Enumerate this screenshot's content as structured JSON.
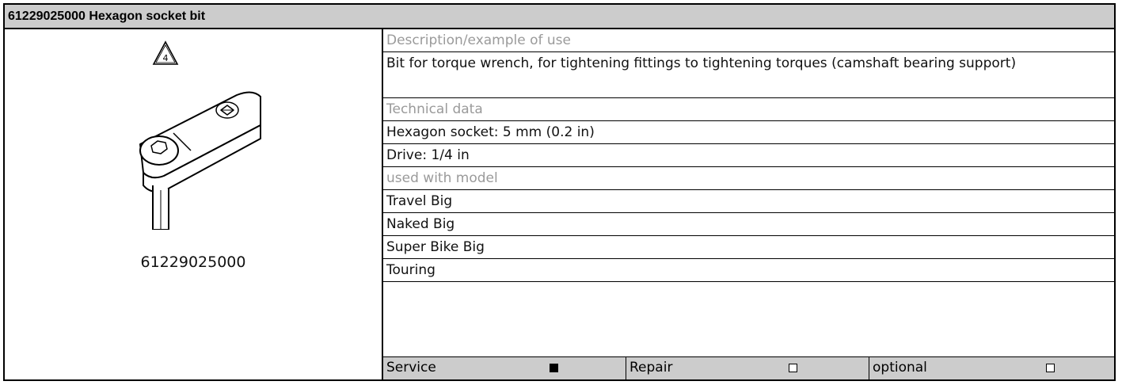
{
  "header": {
    "title": "61229025000 Hexagon socket bit"
  },
  "figure": {
    "icon": "warning-triangle-4-icon",
    "warning_number": "4",
    "part_number": "61229025000"
  },
  "rows": [
    {
      "kind": "header",
      "text": "Description/example of use"
    },
    {
      "kind": "value",
      "text": "Bit for torque wrench, for tightening fittings to tightening torques (camshaft bearing support)"
    },
    {
      "kind": "header",
      "text": "Technical data"
    },
    {
      "kind": "value",
      "text": "Hexagon socket: 5 mm (0.2 in)"
    },
    {
      "kind": "value",
      "text": "Drive: 1/4 in"
    },
    {
      "kind": "header",
      "text": "used with model"
    },
    {
      "kind": "value",
      "text": "Travel Big"
    },
    {
      "kind": "value",
      "text": "Naked Big"
    },
    {
      "kind": "value",
      "text": "Super Bike Big"
    },
    {
      "kind": "value",
      "text": "Touring"
    }
  ],
  "footer": [
    {
      "label": "Service",
      "checked": true
    },
    {
      "label": "Repair",
      "checked": false
    },
    {
      "label": "optional",
      "checked": false
    }
  ]
}
